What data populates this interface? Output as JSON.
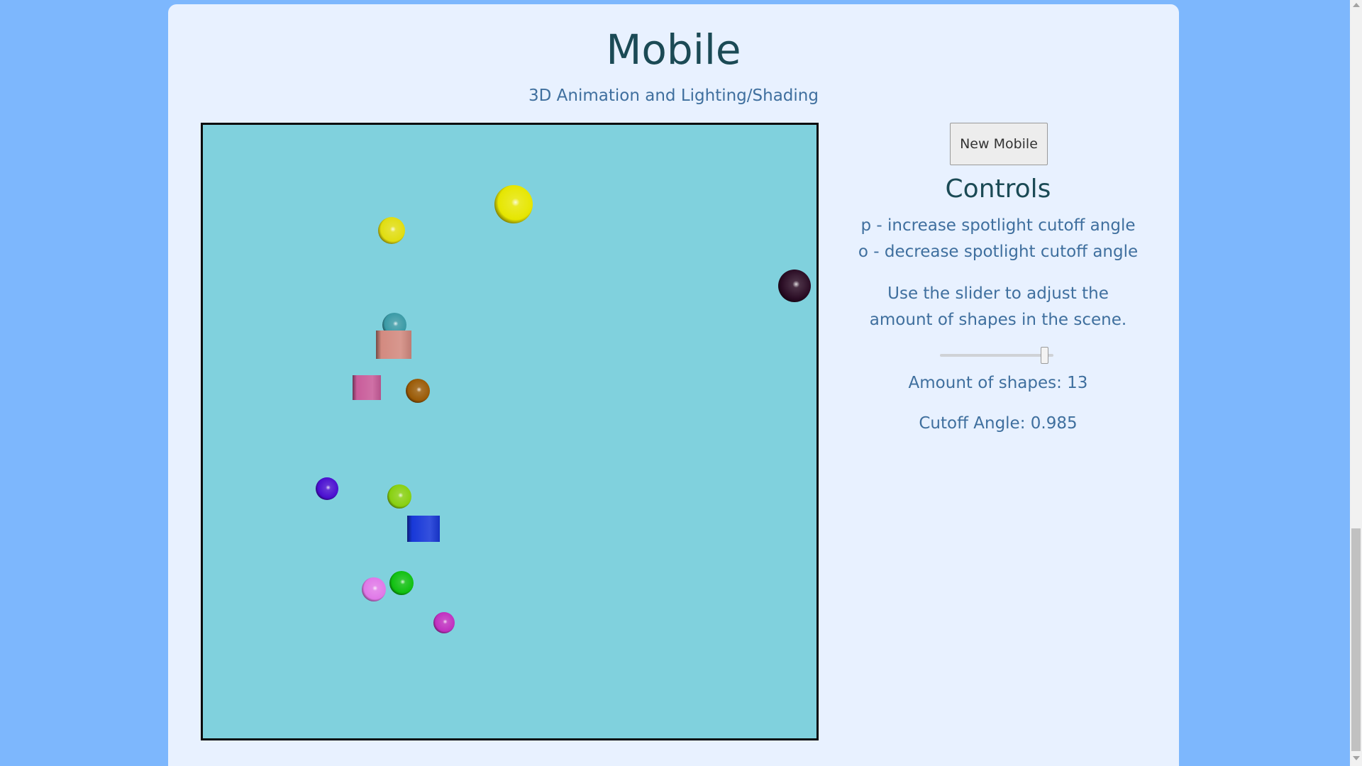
{
  "page": {
    "title": "Mobile",
    "subtitle": "3D Animation and Lighting/Shading"
  },
  "scene": {
    "background_color": "#80d1dd",
    "shapes": [
      {
        "kind": "sphere",
        "color": "#e6e600",
        "name": "yellow-sphere"
      },
      {
        "kind": "sphere",
        "color": "#e0dd10",
        "name": "yellow-sphere-small"
      },
      {
        "kind": "sphere",
        "color": "#2a0c24",
        "name": "dark-sphere"
      },
      {
        "kind": "sphere",
        "color": "#3a9aa6",
        "name": "teal-sphere"
      },
      {
        "kind": "cube",
        "color": "#d38a80",
        "name": "salmon-cube"
      },
      {
        "kind": "cube",
        "color": "#c95c9a",
        "name": "pink-cube"
      },
      {
        "kind": "sphere",
        "color": "#9a5a06",
        "name": "brown-sphere"
      },
      {
        "kind": "sphere",
        "color": "#4a0fd0",
        "name": "purple-sphere"
      },
      {
        "kind": "sphere",
        "color": "#88d010",
        "name": "lime-sphere"
      },
      {
        "kind": "cube",
        "color": "#1838d8",
        "name": "blue-cube"
      },
      {
        "kind": "sphere",
        "color": "#e078e8",
        "name": "violet-sphere"
      },
      {
        "kind": "sphere",
        "color": "#10c010",
        "name": "green-sphere"
      },
      {
        "kind": "sphere",
        "color": "#c030c0",
        "name": "magenta-sphere"
      }
    ]
  },
  "controls": {
    "new_mobile_label": "New Mobile",
    "title": "Controls",
    "key_p": "p - increase spotlight cutoff angle",
    "key_o": "o - decrease spotlight cutoff angle",
    "slider_instructions": "Use the slider to adjust the amount of shapes in the scene.",
    "slider_value": 13,
    "slider_fraction": 0.95,
    "amount_text": "Amount of shapes: 13",
    "cutoff_text": "Cutoff Angle: 0.985"
  }
}
